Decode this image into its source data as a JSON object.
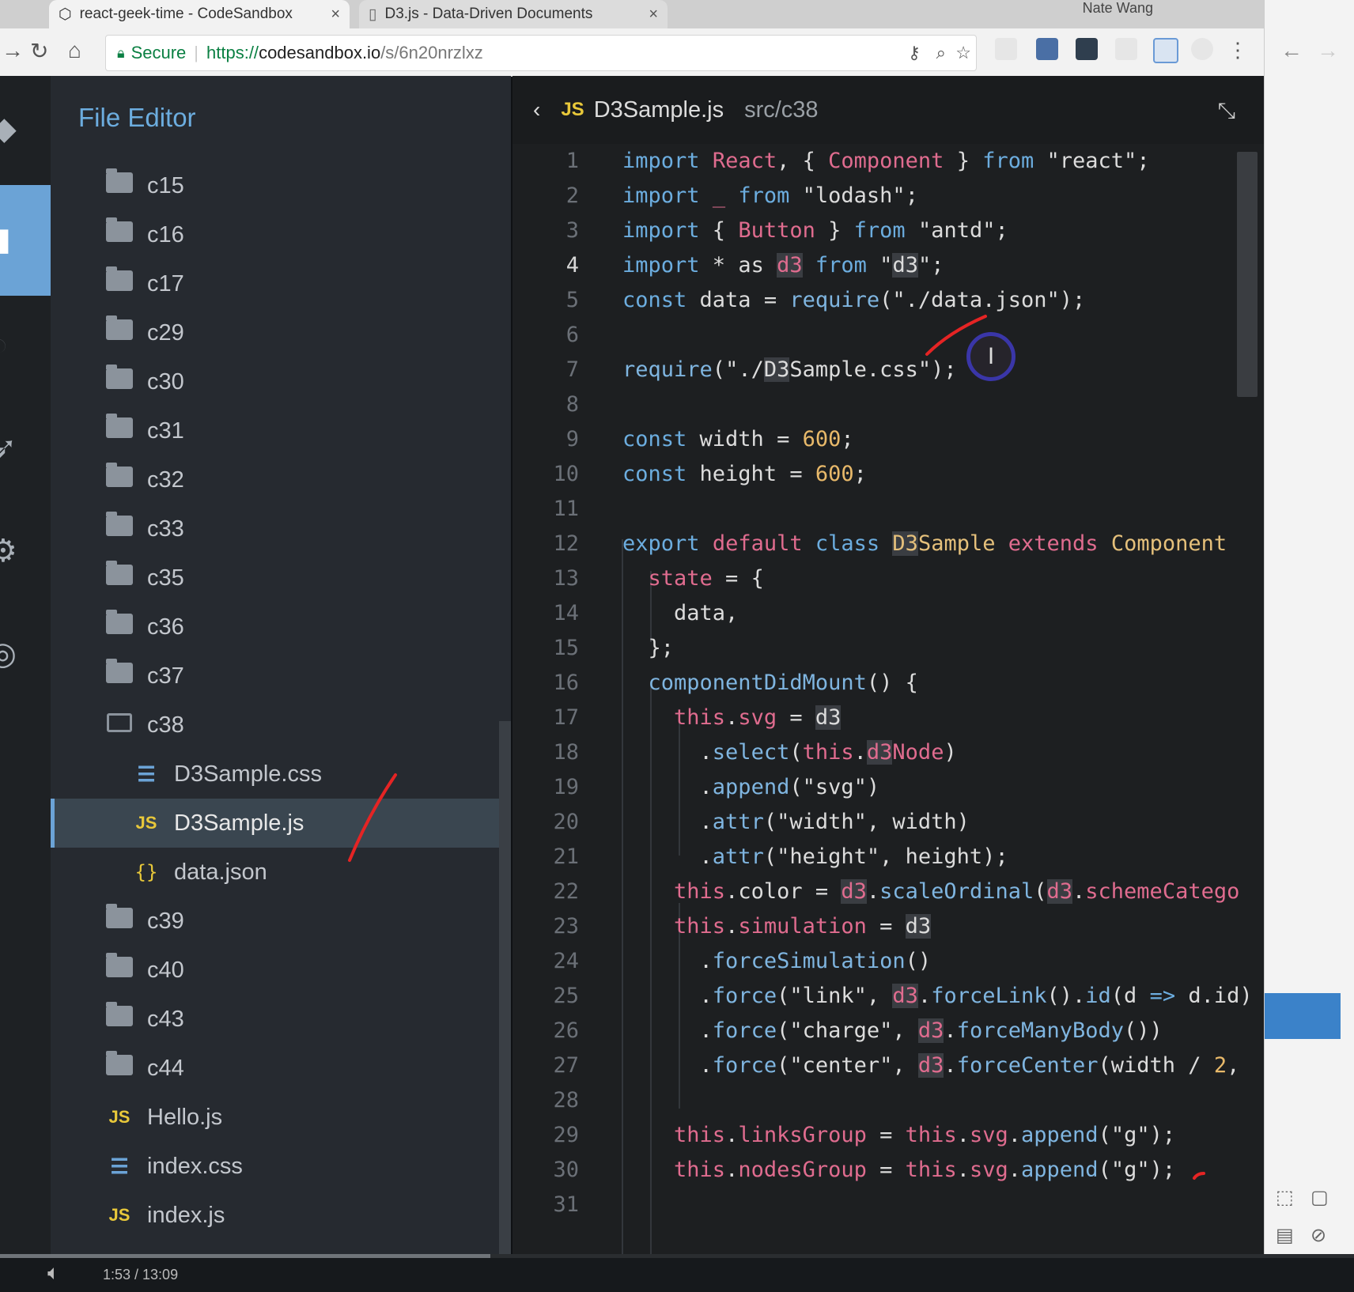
{
  "browser": {
    "profile": "Nate Wang",
    "tabs": [
      {
        "title": "react-geek-time - CodeSandbox",
        "close": "×"
      },
      {
        "title": "D3.js - Data-Driven Documents",
        "close": "×"
      }
    ],
    "secure_label": "Secure",
    "url": {
      "scheme": "https://",
      "host": "codesandbox.io",
      "path": "/s/6n20nrzlxz"
    },
    "icons": {
      "back": "back-arrow-icon",
      "reload": "reload-icon",
      "home": "home-icon",
      "key": "key-icon",
      "zoom": "zoom-icon",
      "star": "star-icon"
    }
  },
  "sidebar": {
    "title": "File Editor",
    "items": [
      {
        "label": "c15",
        "kind": "folder"
      },
      {
        "label": "c16",
        "kind": "folder"
      },
      {
        "label": "c17",
        "kind": "folder"
      },
      {
        "label": "c29",
        "kind": "folder"
      },
      {
        "label": "c30",
        "kind": "folder"
      },
      {
        "label": "c31",
        "kind": "folder"
      },
      {
        "label": "c32",
        "kind": "folder"
      },
      {
        "label": "c33",
        "kind": "folder"
      },
      {
        "label": "c35",
        "kind": "folder"
      },
      {
        "label": "c36",
        "kind": "folder"
      },
      {
        "label": "c37",
        "kind": "folder"
      },
      {
        "label": "c38",
        "kind": "folder-open"
      },
      {
        "label": "D3Sample.css",
        "kind": "css"
      },
      {
        "label": "D3Sample.js",
        "kind": "js"
      },
      {
        "label": "data.json",
        "kind": "json"
      },
      {
        "label": "c39",
        "kind": "folder"
      },
      {
        "label": "c40",
        "kind": "folder"
      },
      {
        "label": "c43",
        "kind": "folder"
      },
      {
        "label": "c44",
        "kind": "folder"
      },
      {
        "label": "Hello.js",
        "kind": "js"
      },
      {
        "label": "index.css",
        "kind": "css"
      },
      {
        "label": "index.js",
        "kind": "js"
      }
    ],
    "js_badge": "JS",
    "json_badge": "{}"
  },
  "editor": {
    "filename": "D3Sample.js",
    "path": "src/c38",
    "badge": "JS",
    "back_icon": "chevron-left-icon",
    "collapse_icon": "collapse-icon",
    "active_line": 4,
    "line_numbers": [
      "1",
      "2",
      "3",
      "4",
      "5",
      "6",
      "7",
      "8",
      "9",
      "10",
      "11",
      "12",
      "13",
      "14",
      "15",
      "16",
      "17",
      "18",
      "19",
      "20",
      "21",
      "22",
      "23",
      "24",
      "25",
      "26",
      "27",
      "28",
      "29",
      "30",
      "31"
    ]
  },
  "player": {
    "time": "1:53 / 13:09"
  },
  "colors": {
    "accent": "#6ba3d6",
    "keyword": "#6caddf",
    "identifier": "#e06c8f",
    "number": "#e8b96a",
    "class": "#e5c07b"
  }
}
